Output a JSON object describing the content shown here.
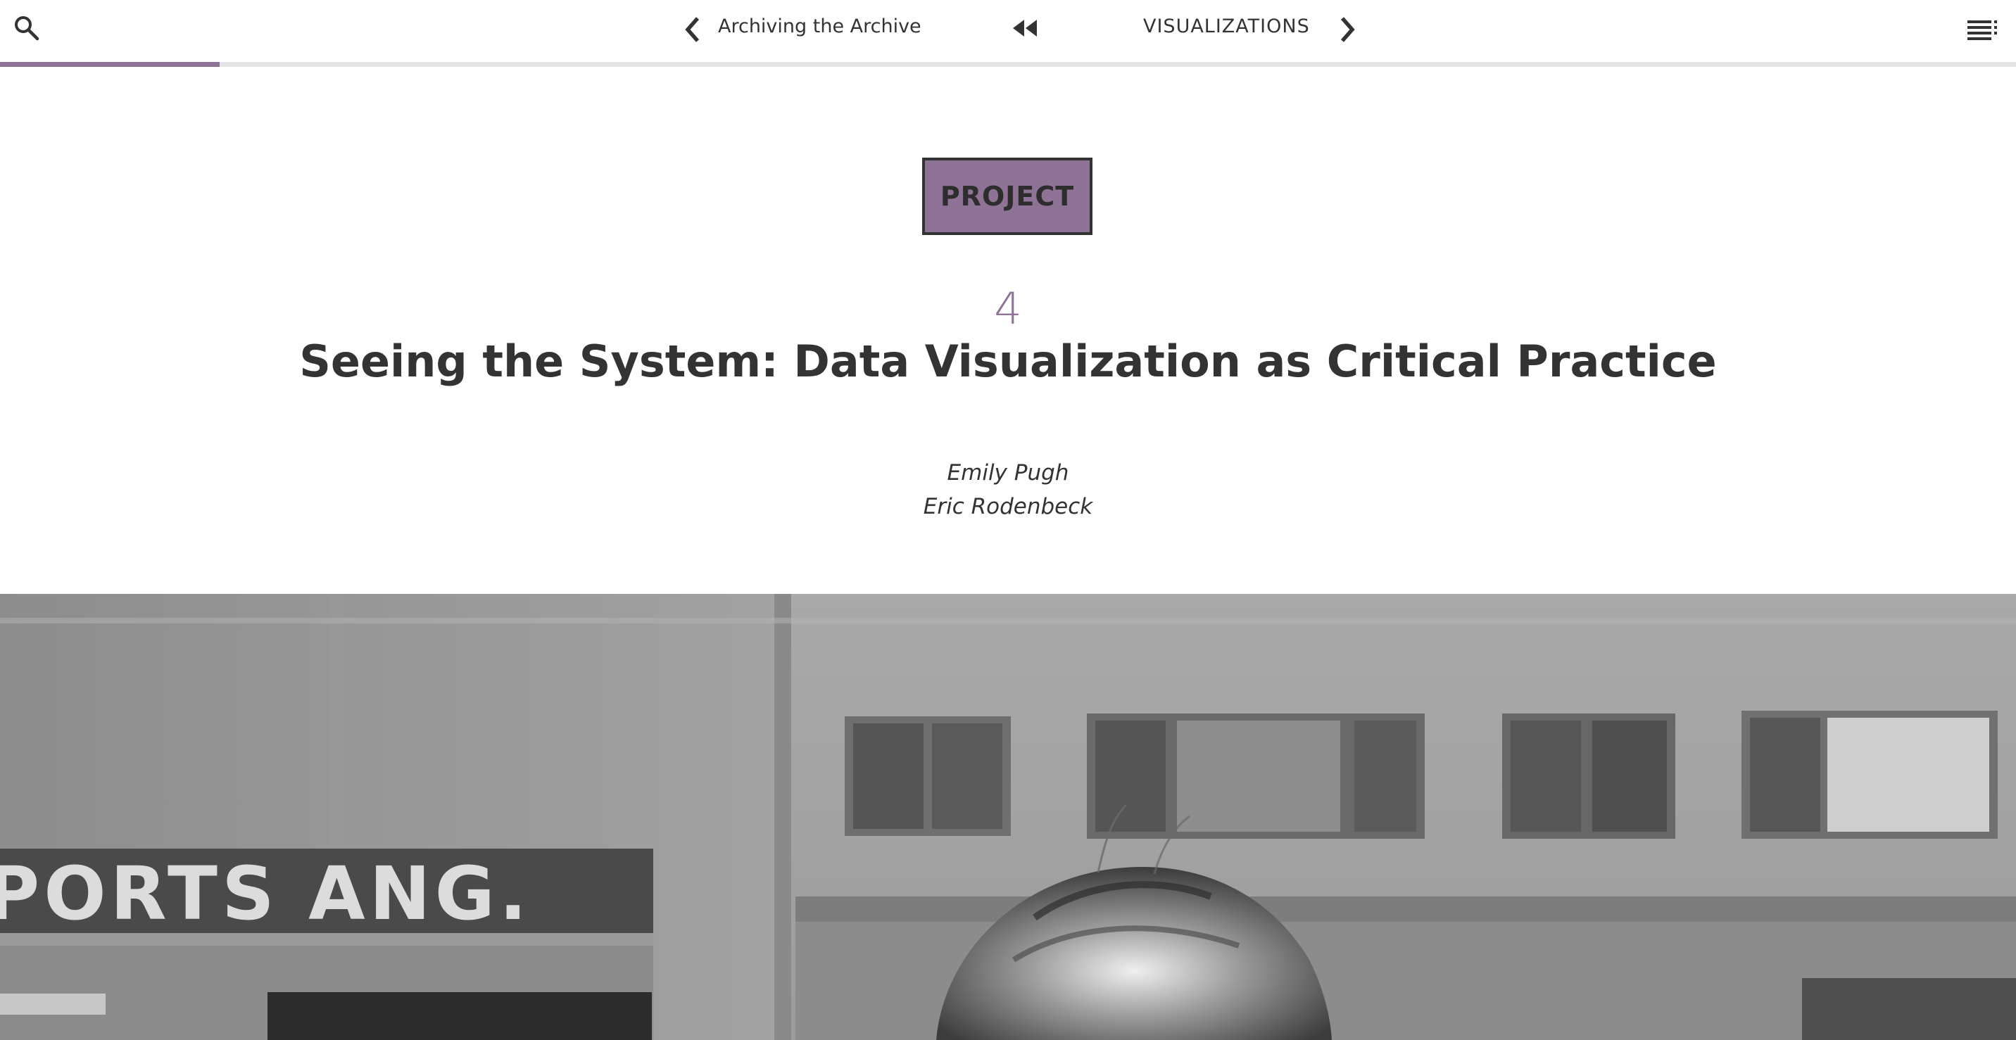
{
  "toolbar": {
    "search_icon": "search-icon",
    "prev_icon": "chevron-left-icon",
    "prev_label": "Archiving the Archive",
    "rewind_icon": "rewind-icon",
    "next_label": "VISUALIZATIONS",
    "next_icon": "chevron-right-icon",
    "menu_icon": "table-of-contents-icon"
  },
  "reading_progress": 0.109,
  "chapter": {
    "badge": "PROJECT",
    "number": "4",
    "title": "Seeing the System: Data Visualization as Critical Practice",
    "authors": [
      "Emily Pugh",
      "Eric Rodenbeck"
    ]
  },
  "hero": {
    "sign_text": "PORTS  ANG."
  },
  "colors": {
    "accent": "#8e7396",
    "text": "#333333",
    "background": "#ffffff",
    "progress_track": "#e4e4e4"
  }
}
